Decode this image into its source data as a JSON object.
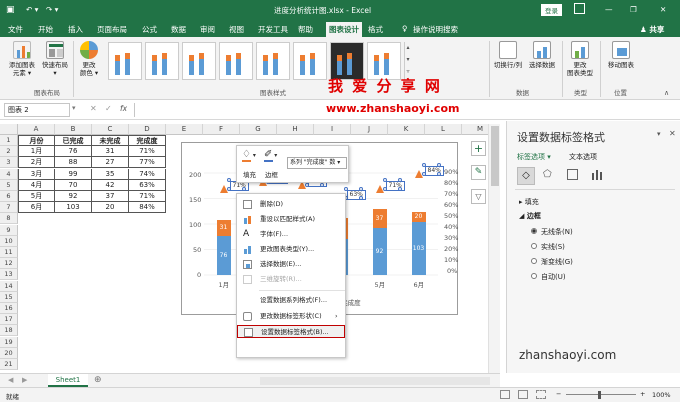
{
  "titlebar": {
    "filename": "进度分析统计图.xlsx - Excel",
    "login": "登录",
    "window_buttons": [
      "—",
      "❐",
      "✕"
    ]
  },
  "tabs": [
    "文件",
    "开始",
    "插入",
    "页面布局",
    "公式",
    "数据",
    "审阅",
    "视图",
    "开发工具",
    "帮助",
    "图表设计",
    "格式"
  ],
  "active_tab": "图表设计",
  "tell_me": "操作说明搜索",
  "share": "共享",
  "ribbon": {
    "add_element": "添加图表\n元素 ▾",
    "quick_layout": "快速布局\n▾",
    "change_colors": "更改\n颜色 ▾",
    "group_layout": "图表布局",
    "group_styles": "图表样式",
    "switch_rowcol": "切换行/列",
    "select_data": "选择数据",
    "group_data": "数据",
    "change_type": "更改\n图表类型",
    "group_type": "类型",
    "move_chart": "移动图表",
    "group_location": "位置"
  },
  "watermark": {
    "big": "我 爱 分 享 网",
    "url": "www.zhanshaoyi.com",
    "bottom": "zhanshaoyi.com"
  },
  "formula_bar": {
    "name_box": "图表 2",
    "fx": "fx"
  },
  "sheet": {
    "columns": [
      "A",
      "B",
      "C",
      "D",
      "E",
      "F",
      "G",
      "H",
      "I",
      "J",
      "K",
      "L",
      "M"
    ],
    "rows": [
      "1",
      "2",
      "3",
      "4",
      "5",
      "6",
      "7",
      "8",
      "9",
      "10",
      "11",
      "12",
      "13",
      "14",
      "15",
      "16",
      "17",
      "18",
      "19",
      "20",
      "21"
    ],
    "table_header": [
      "月份",
      "已完成",
      "未完成",
      "完成度"
    ],
    "table_rows": [
      [
        "1月",
        "76",
        "31",
        "71%"
      ],
      [
        "2月",
        "88",
        "27",
        "77%"
      ],
      [
        "3月",
        "99",
        "35",
        "74%"
      ],
      [
        "4月",
        "70",
        "42",
        "63%"
      ],
      [
        "5月",
        "92",
        "37",
        "71%"
      ],
      [
        "6月",
        "103",
        "20",
        "84%"
      ]
    ],
    "tab": "Sheet1"
  },
  "chart_data": {
    "type": "bar",
    "categories": [
      "1月",
      "2月",
      "3月",
      "4月",
      "5月",
      "6月"
    ],
    "series": [
      {
        "name": "已完成",
        "values": [
          76,
          88,
          99,
          70,
          92,
          103
        ],
        "color": "#5b9bd5"
      },
      {
        "name": "未完成",
        "values": [
          31,
          27,
          35,
          42,
          37,
          20
        ],
        "color": "#ed7d31"
      },
      {
        "name": "完成度",
        "values": [
          71,
          77,
          74,
          63,
          71,
          84
        ],
        "color": "#ed7d31"
      }
    ],
    "percent_labels": [
      "71%",
      "77%",
      "74%",
      "63%",
      "71%",
      "84%"
    ],
    "left_axis_ticks": [
      "200",
      "150",
      "100",
      "50",
      "0"
    ],
    "right_axis_ticks": [
      "90%",
      "80%",
      "70%",
      "60%",
      "50%",
      "40%",
      "30%",
      "20%",
      "10%",
      "0%"
    ],
    "legend_visible": "完成度",
    "ylim": [
      0,
      200
    ]
  },
  "mini_toolbar": {
    "fill": "填充",
    "outline": "边框",
    "series_dropdown": "系列 \"完成度\" 数"
  },
  "context_menu": [
    "删除(D)",
    "重设以匹配样式(A)",
    "字体(F)...",
    "更改图表类型(Y)...",
    "选择数据(E)...",
    "三维旋转(R)...",
    "设置数据系列格式(F)...",
    "更改数据标签形状(C)",
    "设置数据标签格式(B)..."
  ],
  "pane": {
    "title": "设置数据标签格式",
    "tab_label_options": "标签选项",
    "tab_text_options": "文本选项",
    "section_fill": "填充",
    "section_border": "边框",
    "border_options": [
      "无线条(N)",
      "实线(S)",
      "渐变线(G)",
      "自动(U)"
    ]
  },
  "status": {
    "ready": "就绪",
    "zoom": "100%"
  }
}
